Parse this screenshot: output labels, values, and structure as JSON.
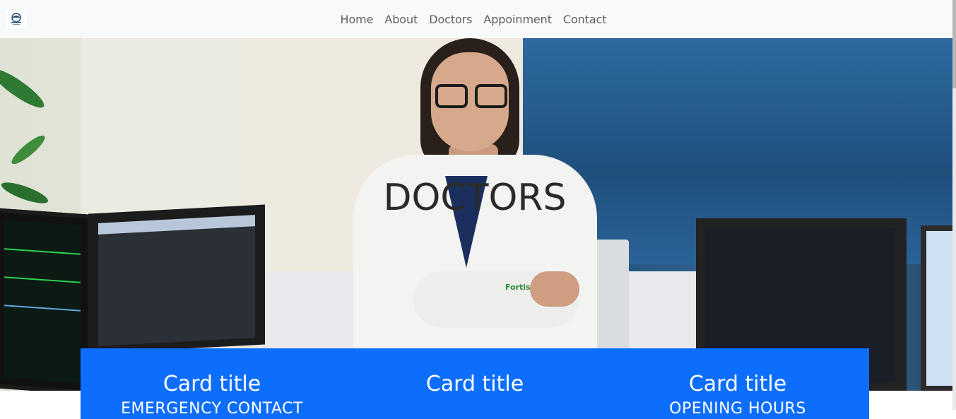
{
  "navbar": {
    "logo_icon": "hospital-logo-icon",
    "links": [
      {
        "label": "Home"
      },
      {
        "label": "About"
      },
      {
        "label": "Doctors"
      },
      {
        "label": "Appoinment"
      },
      {
        "label": "Contact"
      }
    ]
  },
  "hero": {
    "title": "DOCTORS",
    "badge_text": "Fortis"
  },
  "cards": [
    {
      "title": "Card title",
      "subtitle": "EMERGENCY CONTACT"
    },
    {
      "title": "Card title",
      "subtitle": ""
    },
    {
      "title": "Card title",
      "subtitle": "OPENING HOURS"
    }
  ],
  "colors": {
    "navbar_bg": "#f8f9fa",
    "card_strip_bg": "#0d6efd",
    "nav_text": "#5c5f62"
  }
}
